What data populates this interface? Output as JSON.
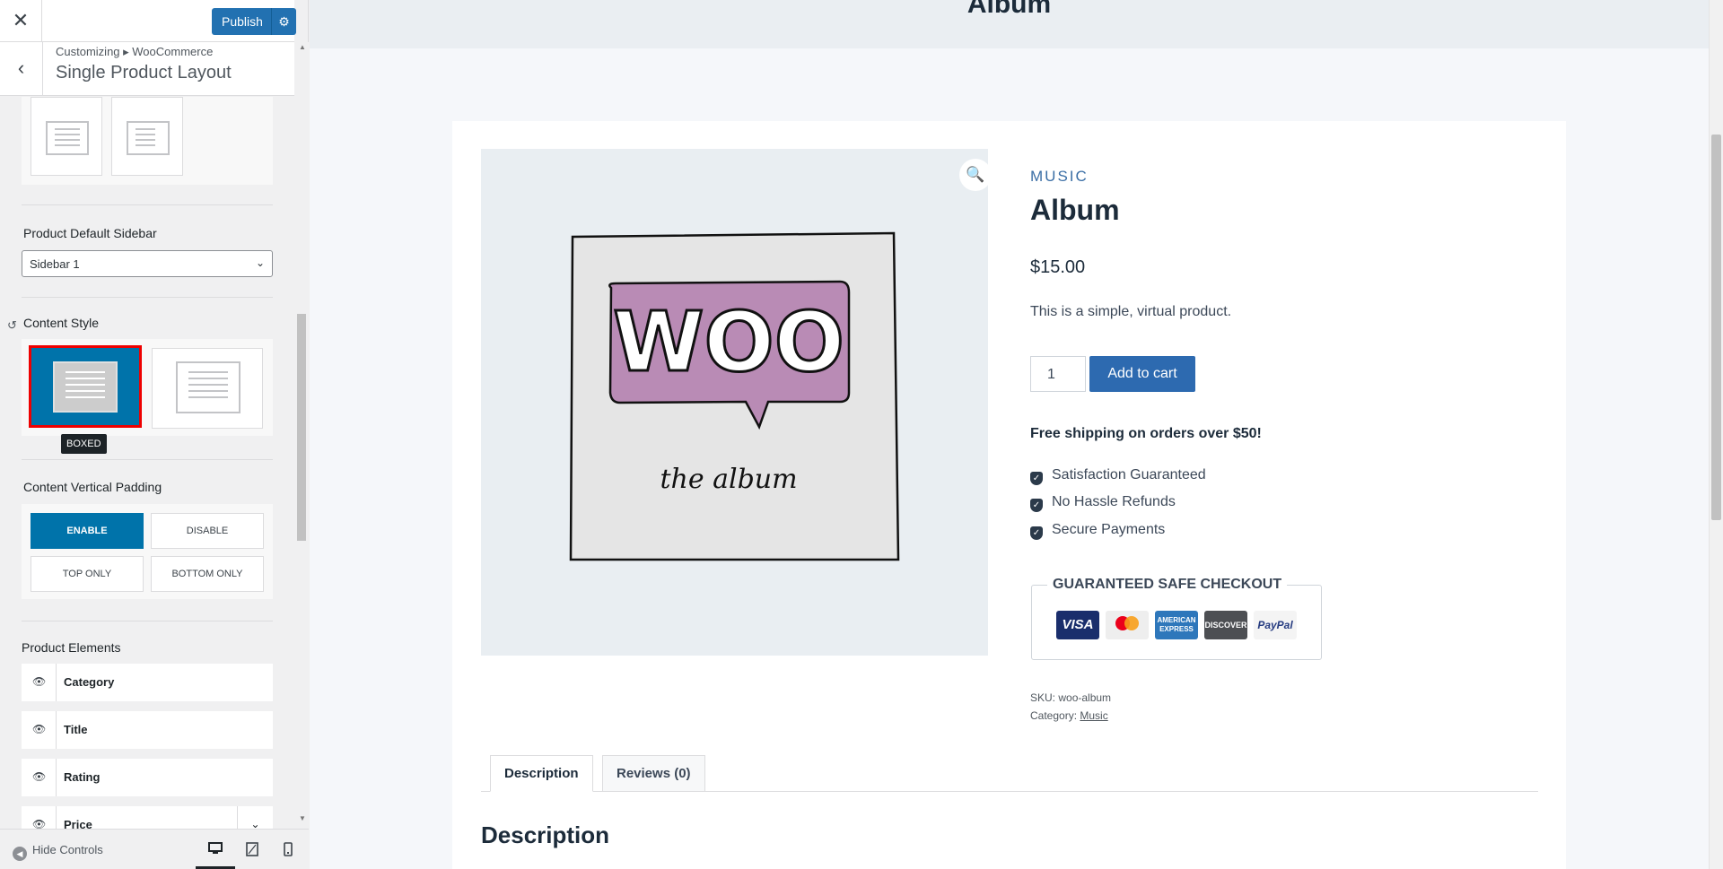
{
  "toolbar": {
    "publish_label": "Publish"
  },
  "section": {
    "breadcrumb": "Customizing ▸ WooCommerce",
    "title": "Single Product Layout"
  },
  "sidebar_control": {
    "label": "Product Default Sidebar",
    "value": "Sidebar 1"
  },
  "content_style": {
    "label": "Content Style",
    "tooltip": "BOXED",
    "selected": "boxed"
  },
  "vertical_padding": {
    "label": "Content Vertical Padding",
    "options": [
      "ENABLE",
      "DISABLE",
      "TOP ONLY",
      "BOTTOM ONLY"
    ],
    "selected": "ENABLE"
  },
  "product_elements": {
    "label": "Product Elements",
    "items": [
      "Category",
      "Title",
      "Rating",
      "Price"
    ]
  },
  "footer": {
    "hide_controls": "Hide Controls",
    "devices": [
      "desktop-icon",
      "tablet-icon",
      "mobile-icon"
    ],
    "active_device": "desktop"
  },
  "preview": {
    "hero_title": "Album",
    "product": {
      "category": "MUSIC",
      "title": "Album",
      "price": "$15.00",
      "short_description": "This is a simple, virtual product.",
      "quantity": "1",
      "add_to_cart": "Add to cart",
      "shipping": "Free shipping on orders over $50!",
      "perks": [
        "Satisfaction Guaranteed",
        "No Hassle Refunds",
        "Secure Payments"
      ],
      "checkout_title": "GUARANTEED SAFE CHECKOUT",
      "payment_methods": [
        "VISA",
        "MasterCard",
        "AMERICAN EXPRESS",
        "DISCOVER",
        "PayPal"
      ],
      "sku_label": "SKU:",
      "sku": "woo-album",
      "category_label": "Category:",
      "category_link": "Music",
      "image_text_1": "WOO",
      "image_text_2": "the album"
    },
    "tabs": [
      "Description",
      "Reviews (0)"
    ],
    "active_tab": "Description",
    "description_heading": "Description"
  },
  "colors": {
    "accent": "#0073aa",
    "publish": "#2271b1",
    "add_to_cart": "#2d6ab0",
    "highlight": "#ee0000"
  }
}
